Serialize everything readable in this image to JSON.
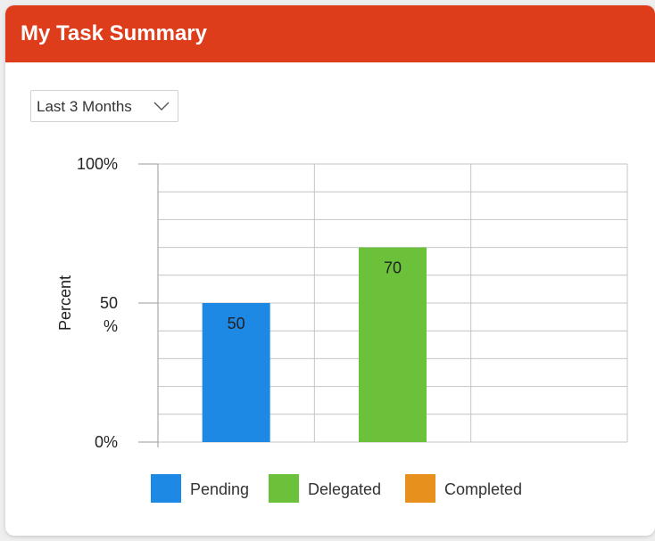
{
  "header": {
    "title": "My Task Summary"
  },
  "filter": {
    "selected": "Last 3 Months",
    "icon": "chevron-down-icon"
  },
  "chart_data": {
    "type": "bar",
    "categories": [
      "Pending",
      "Delegated",
      "Completed"
    ],
    "values": [
      50,
      70,
      0
    ],
    "data_labels": [
      "50",
      "70",
      ""
    ],
    "colors": [
      "#1e88e5",
      "#6bc13a",
      "#e8901e"
    ],
    "ylabel": "Percent",
    "xlabel": "",
    "ylim": [
      0,
      100
    ],
    "ytick_labels": [
      "100%",
      "50\n%",
      "0%"
    ],
    "ytick_values": [
      100,
      50,
      0
    ],
    "grid": true,
    "legend": {
      "position": "bottom",
      "entries": [
        {
          "label": "Pending",
          "color": "#1e88e5"
        },
        {
          "label": "Delegated",
          "color": "#6bc13a"
        },
        {
          "label": "Completed",
          "color": "#e8901e"
        }
      ]
    }
  }
}
